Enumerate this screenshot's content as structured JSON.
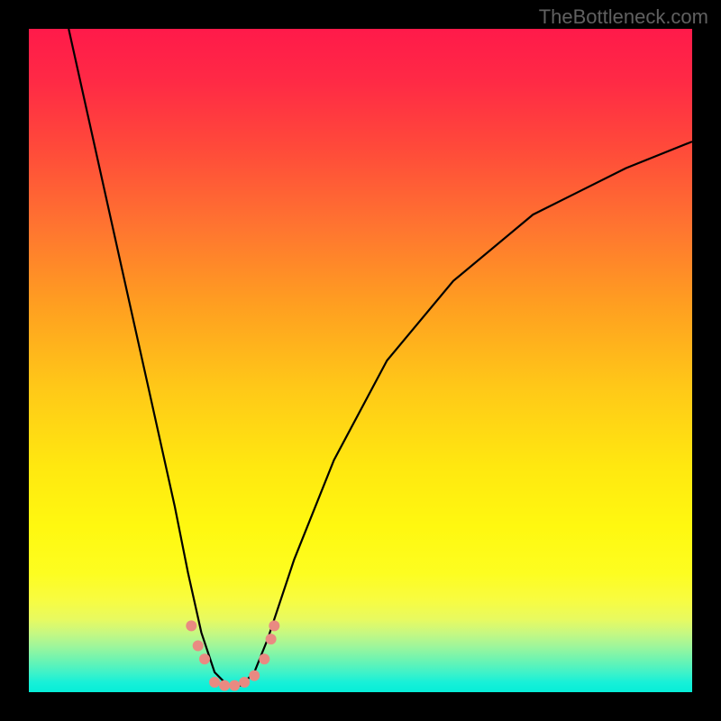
{
  "watermark": "TheBottleneck.com",
  "chart_data": {
    "type": "line",
    "title": "",
    "xlabel": "",
    "ylabel": "",
    "xlim": [
      0,
      100
    ],
    "ylim": [
      0,
      100
    ],
    "gradient_meaning": "green(bottom)=good, red(top)=severe bottleneck",
    "curve_description": "V-shaped bottleneck curve; left branch steep descent, right branch slower ascent",
    "series": [
      {
        "name": "bottleneck-curve",
        "x": [
          6,
          10,
          14,
          18,
          22,
          24,
          26,
          28,
          30,
          32,
          34,
          36,
          40,
          46,
          54,
          64,
          76,
          90,
          100
        ],
        "y": [
          100,
          82,
          64,
          46,
          28,
          18,
          9,
          3,
          1,
          1,
          3,
          8,
          20,
          35,
          50,
          62,
          72,
          79,
          83
        ]
      }
    ],
    "markers": {
      "name": "highlight-dots",
      "points_xy": [
        [
          24.5,
          10
        ],
        [
          25.5,
          7
        ],
        [
          26.5,
          5
        ],
        [
          28,
          1.5
        ],
        [
          29.5,
          1
        ],
        [
          31,
          1
        ],
        [
          32.5,
          1.5
        ],
        [
          34,
          2.5
        ],
        [
          35.5,
          5
        ],
        [
          36.5,
          8
        ],
        [
          37,
          10
        ]
      ],
      "color": "#e98a82",
      "radius": 6
    }
  }
}
